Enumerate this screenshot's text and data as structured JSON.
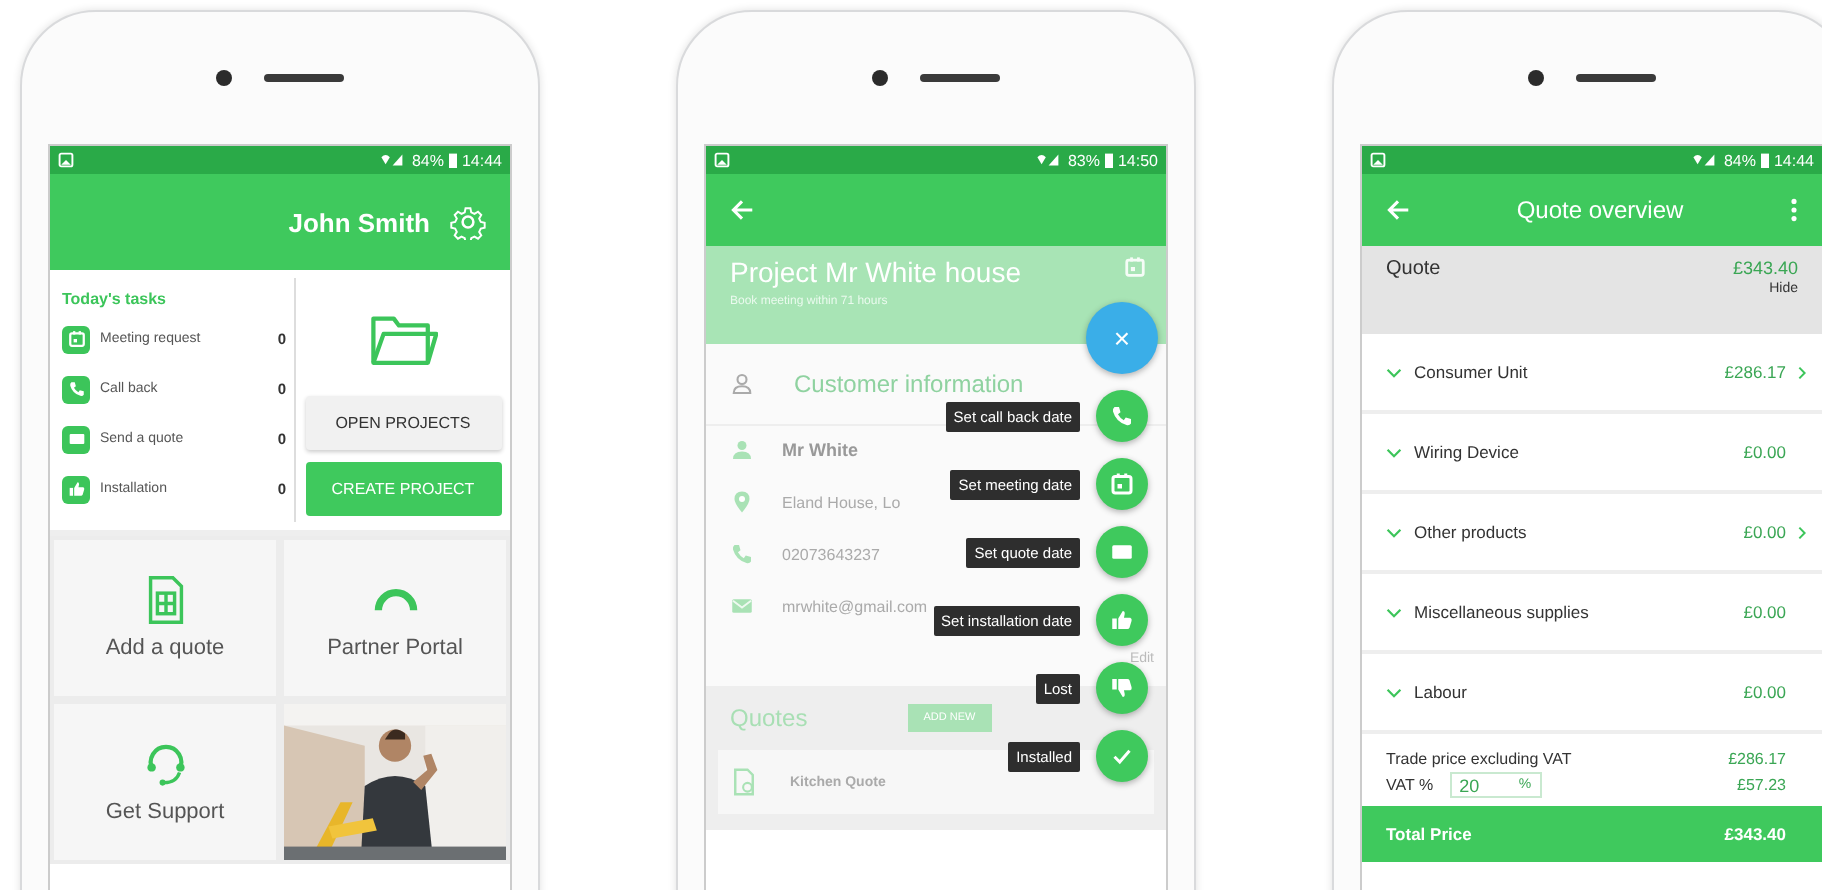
{
  "phones": [
    {
      "kind": "home",
      "status_bar": {
        "battery": "84%",
        "time": "14:44"
      },
      "header": {
        "title": "John Smith"
      },
      "tasks": {
        "title": "Today's tasks",
        "items": [
          {
            "kind": "calendar",
            "label": "Meeting request",
            "count": "0"
          },
          {
            "kind": "phone",
            "label": "Call back",
            "count": "0"
          },
          {
            "kind": "mail",
            "label": "Send a quote",
            "count": "0"
          },
          {
            "kind": "thumb",
            "label": "Installation",
            "count": "0"
          }
        ]
      },
      "buttons": [
        {
          "kind": "secondary",
          "label": "OPEN PROJECTS"
        },
        {
          "kind": "primary",
          "label": "CREATE PROJECT"
        }
      ],
      "tiles": [
        {
          "kind": "quote",
          "label": "Add a quote"
        },
        {
          "kind": "portal",
          "label": "Partner Portal"
        },
        {
          "kind": "support",
          "label": "Get Support"
        },
        {
          "kind": "picture"
        }
      ]
    },
    {
      "kind": "project",
      "status_bar": {
        "battery": "83%",
        "time": "14:50"
      },
      "project": {
        "title": "Project Mr White house",
        "subtitle": "Book meeting within 71 hours"
      },
      "section_title": "Customer information",
      "contact": [
        {
          "kind": "person",
          "text": "Mr White"
        },
        {
          "kind": "location",
          "text": "Eland House, Lo"
        },
        {
          "kind": "phone",
          "text": "02073643237"
        },
        {
          "kind": "mail",
          "text": "mrwhite@gmail.com"
        }
      ],
      "edit_link": "Edit",
      "quotes": {
        "title": "Quotes",
        "button": "ADD NEW",
        "items": [
          "Kitchen Quote"
        ]
      },
      "close_symbol": "×",
      "actions": [
        {
          "kind": "phone",
          "label": "Set call back date"
        },
        {
          "kind": "calendar",
          "label": "Set meeting date"
        },
        {
          "kind": "mail",
          "label": "Set quote date"
        },
        {
          "kind": "thumb",
          "label": "Set installation date"
        },
        {
          "kind": "thumb-down",
          "label": "Lost"
        },
        {
          "kind": "check",
          "label": "Installed"
        }
      ]
    },
    {
      "kind": "quote",
      "status_bar": {
        "battery": "84%",
        "time": "14:44"
      },
      "header": {
        "title": "Quote overview"
      },
      "summary": {
        "label": "Quote",
        "total": "£343.40",
        "toggle": "Hide"
      },
      "sections": [
        {
          "label": "Consumer Unit",
          "amount": "£286.17",
          "has_detail": true
        },
        {
          "label": "Wiring Device",
          "amount": "£0.00",
          "has_detail": false
        },
        {
          "label": "Other products",
          "amount": "£0.00",
          "has_detail": true
        },
        {
          "label": "Miscellaneous supplies",
          "amount": "£0.00",
          "has_detail": false
        },
        {
          "label": "Labour",
          "amount": "£0.00",
          "has_detail": false
        }
      ],
      "trade": {
        "label": "Trade price excluding VAT",
        "amount": "£286.17"
      },
      "vat": {
        "label": "VAT %",
        "value": "20",
        "unit": "%",
        "amount": "£57.23"
      },
      "total": {
        "label": "Total Price",
        "amount": "£343.40"
      }
    }
  ]
}
